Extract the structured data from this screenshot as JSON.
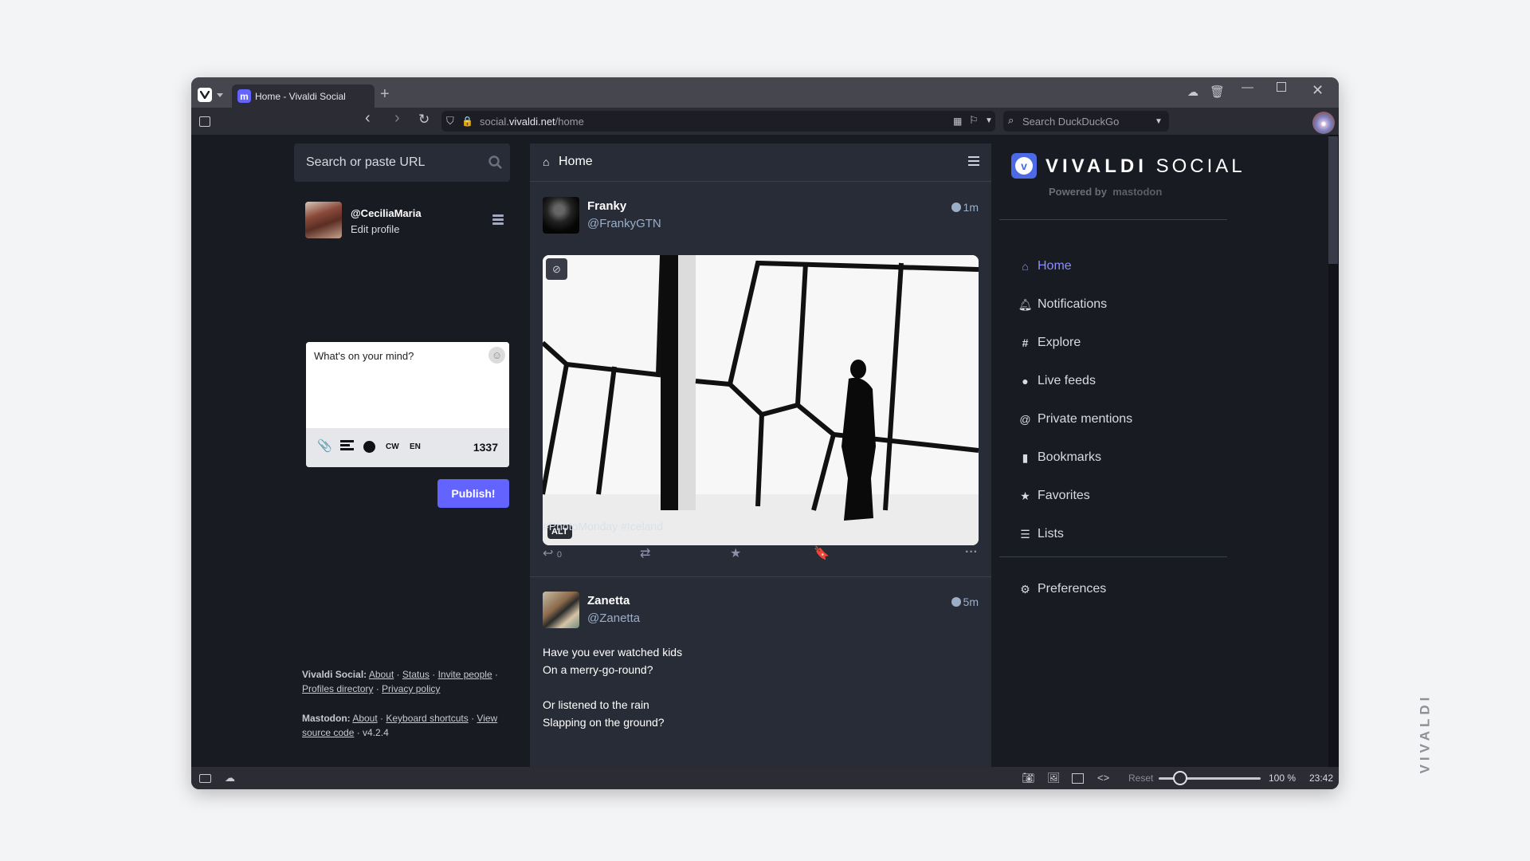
{
  "browser": {
    "tab": {
      "title": "Home - Vivaldi Social",
      "favicon": "mastodon-icon"
    },
    "new_tab_label": "+",
    "window_controls": [
      "minimize",
      "maximize",
      "close"
    ],
    "url": {
      "prefix": "social.",
      "domain": "vivaldi.net",
      "path": "/home"
    },
    "search_placeholder": "Search DuckDuckGo",
    "statusbar": {
      "reset_label": "Reset",
      "zoom_level": "100 %",
      "zoom_percent": 100,
      "clock": "23:42"
    },
    "watermark": "VIVALDI"
  },
  "left": {
    "search_placeholder": "Search or paste URL",
    "account": {
      "handle": "@CeciliaMaria",
      "edit_label": "Edit profile"
    },
    "compose": {
      "placeholder": "What's on your mind?",
      "cw_label": "CW",
      "lang_label": "EN",
      "char_count": "1337",
      "publish_label": "Publish!"
    },
    "footer": {
      "site_label": "Vivaldi Social:",
      "site_links": [
        "About",
        "Status",
        "Invite people",
        "Profiles directory",
        "Privacy policy"
      ],
      "mastodon_label": "Mastodon:",
      "mastodon_links": [
        "About",
        "Keyboard shortcuts",
        "View source code"
      ],
      "version": "v4.2.4"
    }
  },
  "timeline": {
    "title": "Home",
    "posts": [
      {
        "name": "Franky",
        "handle": "@FrankyGTN",
        "time": "1m",
        "alt_label": "ALT",
        "hashtags": "#PhotoMonday #Iceland",
        "reply_count": "0"
      },
      {
        "name": "Zanetta",
        "handle": "@Zanetta",
        "time": "5m",
        "stanzas": [
          [
            "Have you ever watched kids",
            "On a merry-go-round?"
          ],
          [
            "Or listened to the rain",
            "Slapping on the ground?"
          ]
        ]
      }
    ]
  },
  "right": {
    "brand": {
      "primary": "VIVALDI",
      "secondary": "SOCIAL",
      "powered_by": "Powered by",
      "mastodon": "mastodon"
    },
    "nav": [
      {
        "label": "Home",
        "icon": "home-icon",
        "active": true
      },
      {
        "label": "Notifications",
        "icon": "bell-icon",
        "active": false
      },
      {
        "label": "Explore",
        "icon": "hashtag-icon",
        "active": false
      },
      {
        "label": "Live feeds",
        "icon": "globe-icon",
        "active": false
      },
      {
        "label": "Private mentions",
        "icon": "at-icon",
        "active": false
      },
      {
        "label": "Bookmarks",
        "icon": "bookmark-icon",
        "active": false
      },
      {
        "label": "Favorites",
        "icon": "star-icon",
        "active": false
      },
      {
        "label": "Lists",
        "icon": "list-icon",
        "active": false
      }
    ],
    "preferences_label": "Preferences"
  },
  "colors": {
    "accent": "#6364ff",
    "nav_active": "#8c8dff",
    "panel": "#282c37",
    "background": "#191b22",
    "secondary_text": "#9baec8"
  }
}
